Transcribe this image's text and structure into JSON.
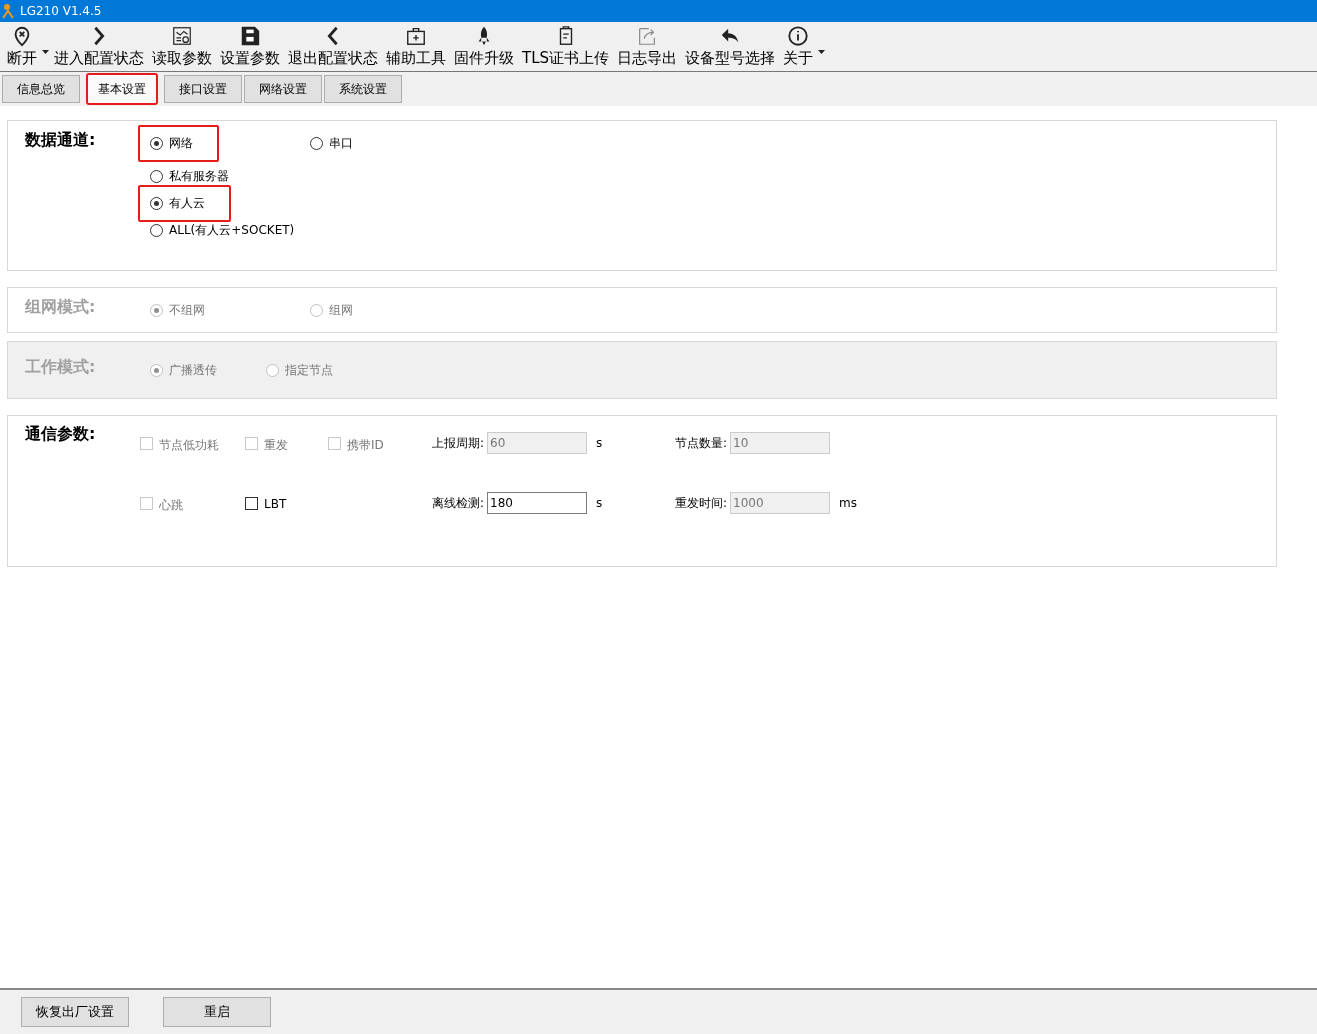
{
  "window": {
    "title": "LG210 V1.4.5"
  },
  "toolbar": [
    {
      "kind": "disconnect",
      "label": "断开",
      "dropdown": true
    },
    {
      "kind": "next",
      "label": "进入配置状态"
    },
    {
      "kind": "read",
      "label": "读取参数"
    },
    {
      "kind": "save",
      "label": "设置参数"
    },
    {
      "kind": "back",
      "label": "退出配置状态"
    },
    {
      "kind": "toolbox",
      "label": "辅助工具"
    },
    {
      "kind": "rocket",
      "label": "固件升级"
    },
    {
      "kind": "clipboard",
      "label": "TLS证书上传"
    },
    {
      "kind": "export",
      "label": "日志导出"
    },
    {
      "kind": "undo",
      "label": "设备型号选择"
    },
    {
      "kind": "info",
      "label": "关于"
    }
  ],
  "toolbar_overflow": true,
  "tabs": [
    {
      "label": "信息总览",
      "selected": false,
      "highlighted": false
    },
    {
      "label": "基本设置",
      "selected": true,
      "highlighted": true
    },
    {
      "label": "接口设置",
      "selected": false,
      "highlighted": false
    },
    {
      "label": "网络设置",
      "selected": false,
      "highlighted": false
    },
    {
      "label": "系统设置",
      "selected": false,
      "highlighted": false
    }
  ],
  "sections": [
    {
      "kind": "radios",
      "label": "数据通道:",
      "disabled": false,
      "shaded": false,
      "rows": [
        [
          {
            "label": "网络",
            "selected": true,
            "highlighted": true
          },
          {
            "label": "串口",
            "selected": false,
            "highlighted": false
          }
        ],
        [
          {
            "label": "私有服务器",
            "selected": false,
            "highlighted": false
          }
        ],
        [
          {
            "label": "有人云",
            "selected": true,
            "highlighted": true
          }
        ],
        [
          {
            "label": "ALL(有人云+SOCKET)",
            "selected": false,
            "highlighted": false
          }
        ]
      ]
    },
    {
      "kind": "radios",
      "label": "组网模式:",
      "disabled": true,
      "shaded": false,
      "rows": [
        [
          {
            "label": "不组网",
            "selected": true,
            "highlighted": false
          },
          {
            "label": "组网",
            "selected": false,
            "highlighted": false
          }
        ]
      ]
    },
    {
      "kind": "radios",
      "label": "工作模式:",
      "disabled": true,
      "shaded": true,
      "rows": [
        [
          {
            "label": "广播透传",
            "selected": true,
            "highlighted": false
          },
          {
            "label": "指定节点",
            "selected": false,
            "highlighted": false
          }
        ]
      ]
    },
    {
      "kind": "params",
      "label": "通信参数:",
      "disabled": false,
      "shaded": false,
      "rows": [
        [
          {
            "kind": "checkbox",
            "label": "节点低功耗",
            "checked": false,
            "disabled": true
          },
          {
            "kind": "checkbox",
            "label": "重发",
            "checked": false,
            "disabled": true
          },
          {
            "kind": "checkbox",
            "label": "携带ID",
            "checked": false,
            "disabled": true
          },
          {
            "kind": "field",
            "label": "上报周期:",
            "value": "60",
            "unit": "s",
            "disabled": true
          },
          {
            "kind": "field",
            "label": "节点数量:",
            "value": "10",
            "disabled": true
          }
        ],
        [
          {
            "kind": "checkbox",
            "label": "心跳",
            "checked": false,
            "disabled": true
          },
          {
            "kind": "checkbox",
            "label": "LBT",
            "checked": false,
            "disabled": false
          },
          "",
          {
            "kind": "field",
            "label": "离线检测:",
            "value": "180",
            "unit": "s",
            "disabled": false
          },
          {
            "kind": "field",
            "label": "重发时间:",
            "value": "1000",
            "unit": "ms",
            "disabled": true
          }
        ]
      ]
    }
  ],
  "footer_buttons": [
    "恢复出厂设置",
    "重启"
  ]
}
